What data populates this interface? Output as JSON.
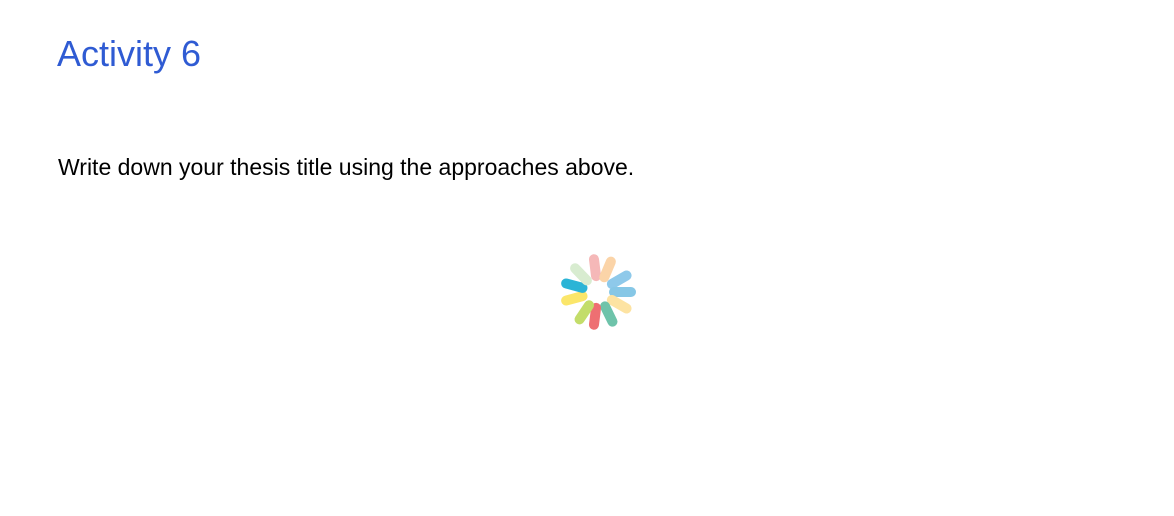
{
  "activity": {
    "title": "Activity 6",
    "instruction": "Write down your thesis title using the approaches above."
  },
  "loading_spinner": {
    "icon": "loading-spinner-icon",
    "segment_colors": [
      "#f5b8b8",
      "#fbd4a8",
      "#8ec9ea",
      "#86c7e6",
      "#fde3a2",
      "#6ec3aa",
      "#ee6f72",
      "#c3dd6a",
      "#fbe66a",
      "#2bb4d6",
      "#d8ecd0"
    ]
  }
}
